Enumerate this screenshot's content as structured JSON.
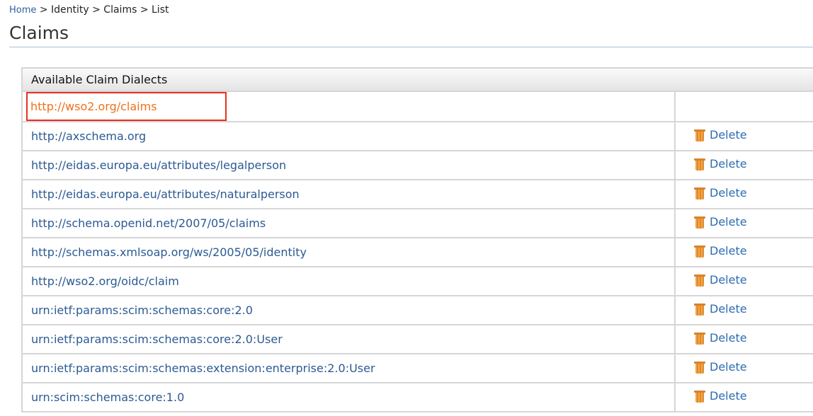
{
  "breadcrumb": {
    "home": "Home",
    "rest": " > Identity > Claims > List"
  },
  "page_title": "Claims",
  "table": {
    "header": "Available Claim Dialects",
    "delete_label": "Delete",
    "rows": [
      {
        "dialect": "http://wso2.org/claims",
        "deletable": false
      },
      {
        "dialect": "http://axschema.org",
        "deletable": true
      },
      {
        "dialect": "http://eidas.europa.eu/attributes/legalperson",
        "deletable": true
      },
      {
        "dialect": "http://eidas.europa.eu/attributes/naturalperson",
        "deletable": true
      },
      {
        "dialect": "http://schema.openid.net/2007/05/claims",
        "deletable": true
      },
      {
        "dialect": "http://schemas.xmlsoap.org/ws/2005/05/identity",
        "deletable": true
      },
      {
        "dialect": "http://wso2.org/oidc/claim",
        "deletable": true
      },
      {
        "dialect": "urn:ietf:params:scim:schemas:core:2.0",
        "deletable": true
      },
      {
        "dialect": "urn:ietf:params:scim:schemas:core:2.0:User",
        "deletable": true
      },
      {
        "dialect": "urn:ietf:params:scim:schemas:extension:enterprise:2.0:User",
        "deletable": true
      },
      {
        "dialect": "urn:scim:schemas:core:1.0",
        "deletable": true
      }
    ]
  }
}
